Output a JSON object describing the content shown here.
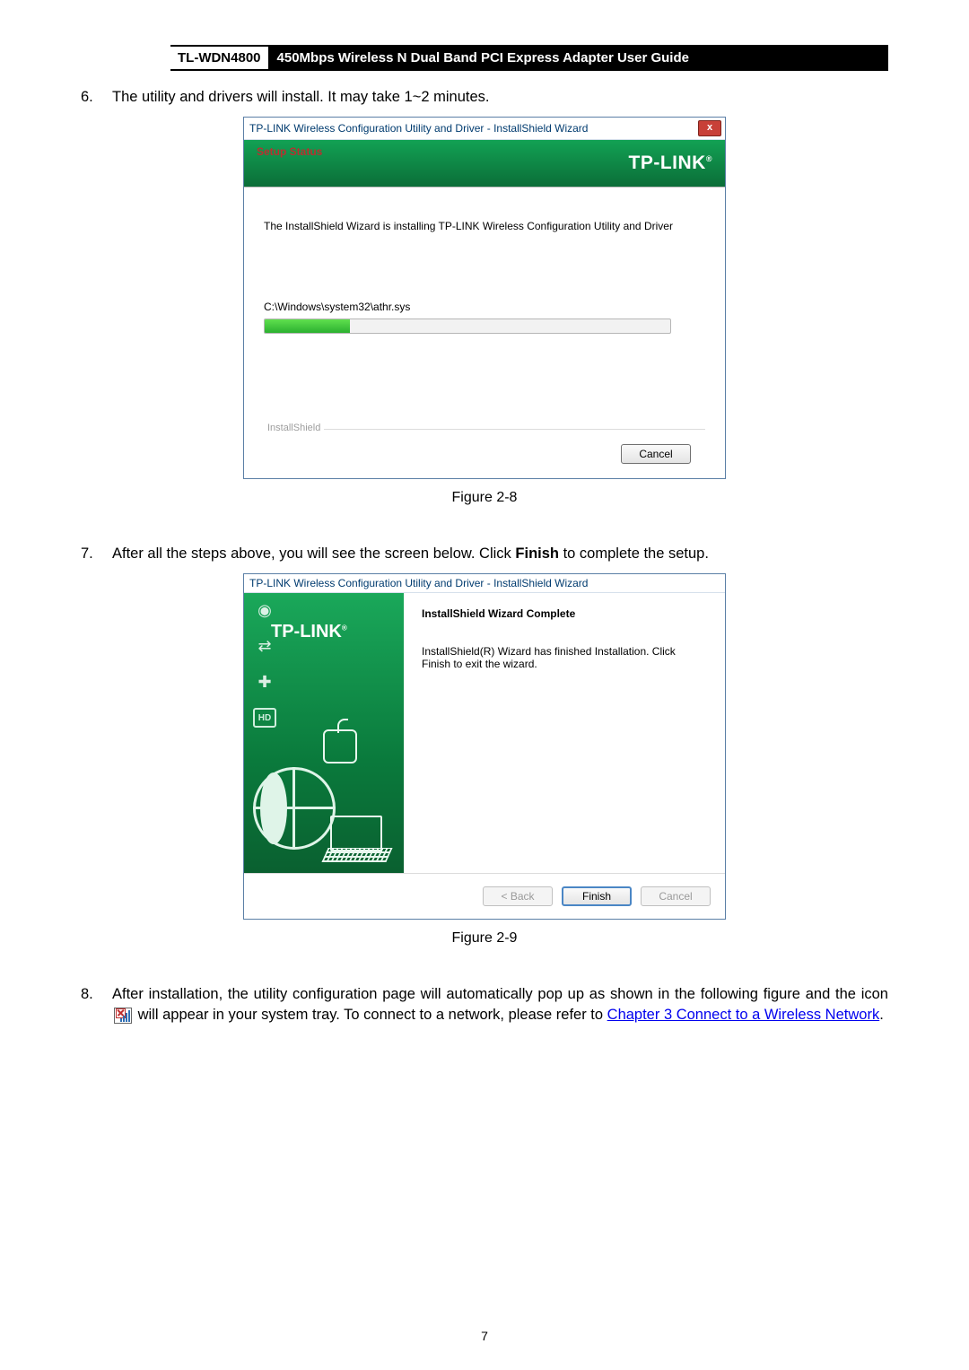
{
  "header": {
    "model": "TL-WDN4800",
    "title": "450Mbps Wireless N Dual Band PCI Express Adapter User Guide"
  },
  "steps": {
    "s6": {
      "num": "6.",
      "text": "The utility and drivers will install. It may take 1~2 minutes."
    },
    "s7": {
      "num": "7.",
      "pre": "After all the steps above, you will see the screen below. Click ",
      "bold": "Finish",
      "post": " to complete the setup."
    },
    "s8": {
      "num": "8.",
      "pre": "After installation, the utility configuration page will automatically pop up as shown in the following figure and the icon ",
      "mid": " will appear in your system tray. To connect to a network, please refer to ",
      "link": "Chapter 3 Connect to a Wireless Network",
      "post": "."
    }
  },
  "captions": {
    "fig28": "Figure 2-8",
    "fig29": "Figure 2-9"
  },
  "dialog1": {
    "title": "TP-LINK Wireless Configuration Utility and Driver - InstallShield Wizard",
    "close": "x",
    "setup": "Setup Status",
    "logo": "TP-LINK",
    "status": "The InstallShield Wizard is installing TP-LINK Wireless Configuration Utility and Driver",
    "path": "C:\\Windows\\system32\\athr.sys",
    "footerLabel": "InstallShield",
    "cancel": "Cancel"
  },
  "dialog2": {
    "title": "TP-LINK Wireless Configuration Utility and Driver - InstallShield Wizard",
    "logo": "TP-LINK",
    "hd": "HD",
    "heading": "InstallShield Wizard Complete",
    "body": "InstallShield(R) Wizard has finished Installation. Click Finish to exit the wizard.",
    "back": "< Back",
    "finish": "Finish",
    "cancel": "Cancel"
  },
  "pageNumber": "7"
}
